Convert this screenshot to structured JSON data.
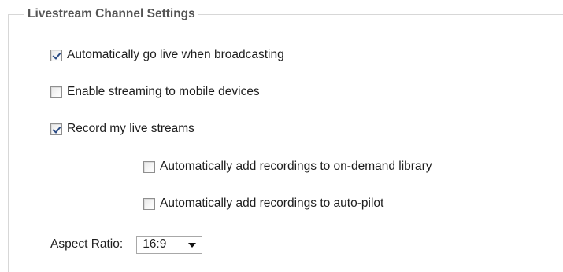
{
  "section": {
    "title": "Livestream Channel Settings"
  },
  "options": [
    {
      "label": "Automatically go live when broadcasting",
      "checked": true
    },
    {
      "label": "Enable streaming to mobile devices",
      "checked": false
    },
    {
      "label": "Record my live streams",
      "checked": true
    },
    {
      "label": "Automatically add recordings to on-demand library",
      "checked": false
    },
    {
      "label": "Automatically add recordings to auto-pilot",
      "checked": false
    }
  ],
  "aspect_ratio": {
    "label": "Aspect Ratio:",
    "selected": "16:9",
    "icon": "chevron-down-icon"
  }
}
